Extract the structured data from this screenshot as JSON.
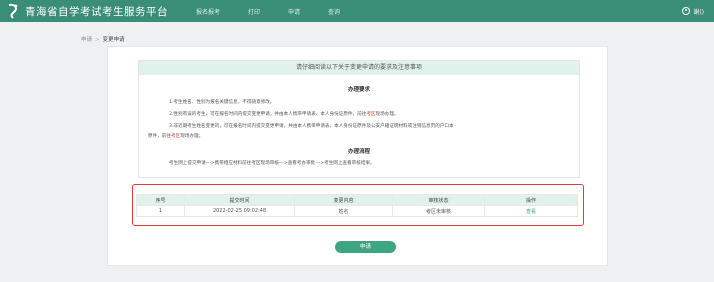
{
  "header": {
    "site_title": "青海省自学考试考生服务平台",
    "nav": [
      "报名报考",
      "打印",
      "申请",
      "查询"
    ],
    "user_name": "谢()"
  },
  "breadcrumb": {
    "parent": "申请",
    "separator": ">",
    "current": "变更申请"
  },
  "notice": {
    "header": "请仔细阅读以下关于变更申请的要求及注意事项",
    "requirements_title": "办理要求",
    "req1": "1.考生姓名、性别为报名关键信息，不得随意修改。",
    "req2_pre": "2.性别有误的考生，可在报名时间内提交变更申请，并由本人携带申请表、本人身份证原件，前往",
    "req2_red": "考区",
    "req2_post": "现场办理。",
    "req3_pre": "3.非近期考生姓名变更的，可在报名时间内提交变更申请，并由本人携带申请表、本人身份证原件及公安户籍证明材料或注销信息页的户口本",
    "req3_line2_pre": "原件，前往",
    "req3_red": "考区",
    "req3_post": "现场办理。",
    "process_title": "办理流程",
    "process": "考生网上提交申请--->携带相应材料前往考区现场审核--->查看考办审批--->考生网上查看审核结果。"
  },
  "table": {
    "headers": [
      "序号",
      "提交时间",
      "变更内容",
      "审核状态",
      "操作"
    ],
    "rows": [
      {
        "index": "1",
        "time": "2022-02-25 09:02:48",
        "content": "姓名",
        "status": "考区未审核",
        "action": "查看"
      }
    ]
  },
  "apply_button": "申请",
  "colors": {
    "brand": "#3a8e78",
    "accent": "#3ea583",
    "highlight": "#e23a3a"
  }
}
